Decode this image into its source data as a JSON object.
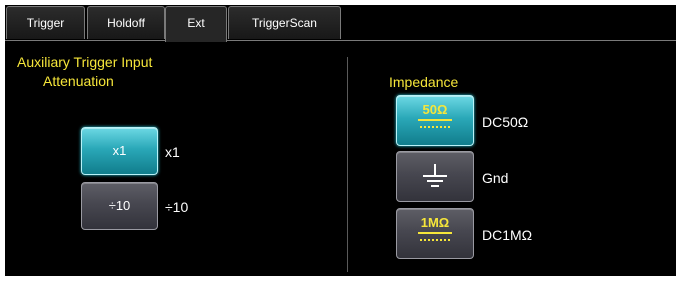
{
  "tabs": [
    {
      "label": "Trigger",
      "active": false
    },
    {
      "label": "Holdoff",
      "active": false
    },
    {
      "label": "Ext",
      "active": true
    },
    {
      "label": "TriggerScan",
      "active": false
    }
  ],
  "attenuation": {
    "title_line1": "Auxiliary Trigger Input",
    "title_line2": "Attenuation",
    "options": [
      {
        "button_label": "x1",
        "side_label": "x1",
        "selected": true
      },
      {
        "button_label": "÷10",
        "side_label": "÷10",
        "selected": false
      }
    ]
  },
  "impedance": {
    "title": "Impedance",
    "options": [
      {
        "glyph": "50Ω",
        "icon": "dc50-coupling-icon",
        "side_label": "DC50Ω",
        "selected": true
      },
      {
        "glyph": "",
        "icon": "ground-icon",
        "side_label": "Gnd",
        "selected": false
      },
      {
        "glyph": "1MΩ",
        "icon": "dc1m-coupling-icon",
        "side_label": "DC1MΩ",
        "selected": false
      }
    ]
  },
  "colors": {
    "accent_yellow": "#f6e63a",
    "selected_cyan": "#2aa8b8",
    "background": "#000000",
    "text": "#ffffff"
  }
}
